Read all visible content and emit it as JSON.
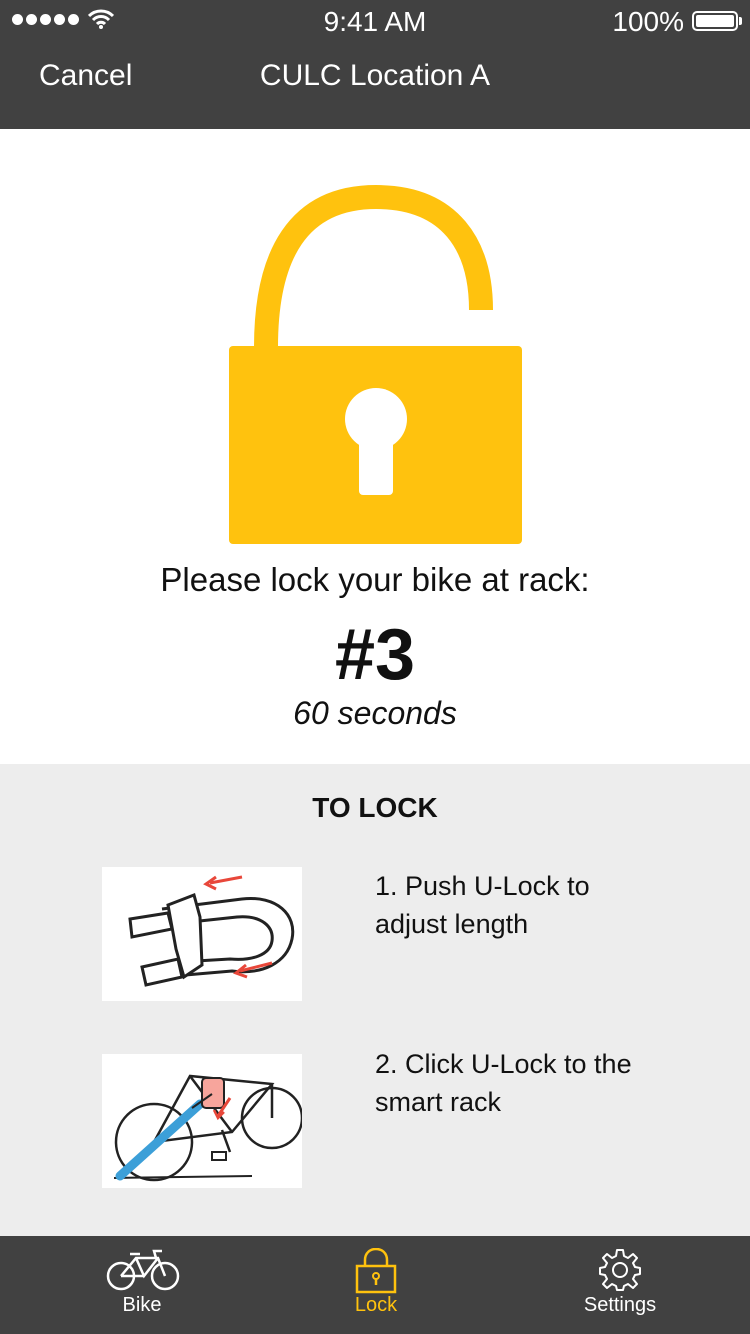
{
  "status_bar": {
    "time": "9:41 AM",
    "battery": "100%"
  },
  "nav": {
    "cancel_label": "Cancel",
    "title": "CULC Location A"
  },
  "main": {
    "prompt": "Please lock your bike at rack:",
    "rack_number": "#3",
    "countdown": "60 seconds"
  },
  "instructions": {
    "title": "TO LOCK",
    "steps": [
      {
        "line1": "1. Push U-Lock to",
        "line2": "adjust length"
      },
      {
        "line1": "2. Click U-Lock to the",
        "line2": "smart rack"
      }
    ]
  },
  "tabbar": {
    "tabs": [
      {
        "label": "Bike",
        "icon": "bike-icon"
      },
      {
        "label": "Lock",
        "icon": "lock-icon"
      },
      {
        "label": "Settings",
        "icon": "gear-icon"
      }
    ]
  },
  "colors": {
    "accent": "#FFC20E",
    "bar": "#414141",
    "panel": "#EDEDED",
    "arrow": "#E8473A",
    "ulock_blue": "#3C9FD8"
  }
}
